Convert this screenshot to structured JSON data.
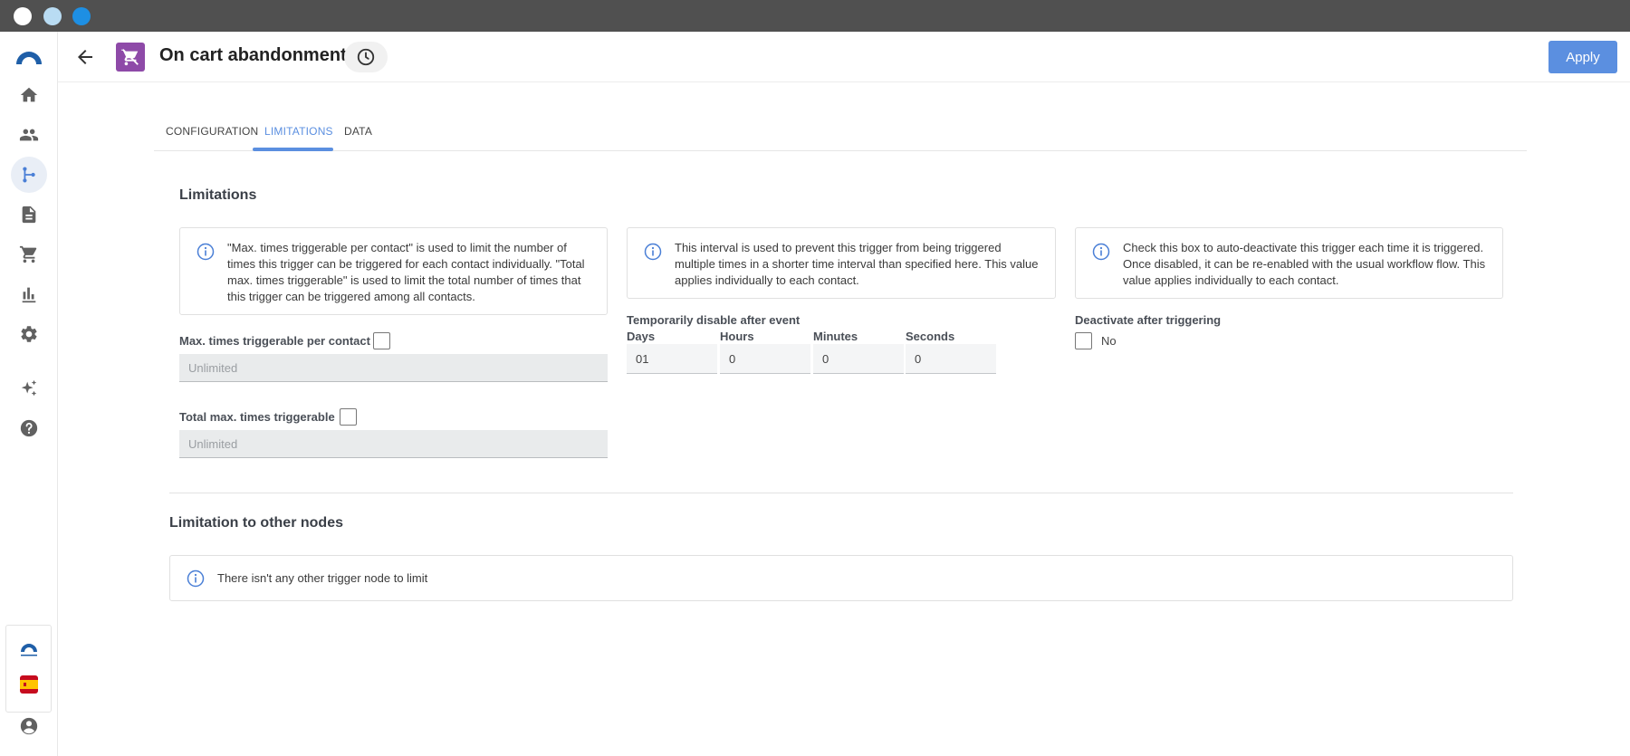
{
  "app": {
    "title": "On cart abandonment",
    "apply_label": "Apply"
  },
  "sidebar": {
    "items": [
      {
        "name": "home",
        "icon": "home-icon"
      },
      {
        "name": "contacts",
        "icon": "people-icon"
      },
      {
        "name": "workflows",
        "icon": "workflow-icon",
        "active": true
      },
      {
        "name": "documents",
        "icon": "document-icon"
      },
      {
        "name": "cart",
        "icon": "cart-icon"
      },
      {
        "name": "reports",
        "icon": "bar-chart-icon"
      },
      {
        "name": "settings",
        "icon": "gear-icon"
      },
      {
        "name": "ai",
        "icon": "sparkles-icon"
      },
      {
        "name": "help",
        "icon": "help-icon"
      }
    ],
    "bottom": {
      "logo_icon": "connectif-logo-icon",
      "flag_icon": "spain-flag-icon",
      "user_icon": "account-icon"
    }
  },
  "tabs": [
    {
      "label": "CONFIGURATION"
    },
    {
      "label": "LIMITATIONS",
      "active": true
    },
    {
      "label": "DATA"
    }
  ],
  "limitations": {
    "title": "Limitations",
    "info_contact": "\"Max. times triggerable per contact\" is used to limit the number of times this trigger can be triggered for each contact individually. \"Total max. times triggerable\" is used to limit the total number of times that this trigger can be triggered among all contacts.",
    "info_interval": "This interval is used to prevent this trigger from being triggered multiple times in a shorter time interval than specified here. This value applies individually to each contact.",
    "info_deactivate": "Check this box to auto-deactivate this trigger each time it is triggered. Once disabled, it can be re-enabled with the usual workflow flow. This value applies individually to each contact.",
    "max_per_contact_label": "Max. times triggerable per contact",
    "max_per_contact_placeholder": "Unlimited",
    "total_max_label": "Total max. times triggerable",
    "total_max_placeholder": "Unlimited",
    "temp_disable_label": "Temporarily disable after event",
    "days_label": "Days",
    "hours_label": "Hours",
    "minutes_label": "Minutes",
    "seconds_label": "Seconds",
    "days_value": "01",
    "hours_value": "0",
    "minutes_value": "0",
    "seconds_value": "0",
    "deactivate_label": "Deactivate after triggering",
    "deactivate_value": "No"
  },
  "other_nodes": {
    "title": "Limitation to other nodes",
    "info": "There isn't any other trigger node to limit"
  },
  "colors": {
    "accent": "#5b8fe0",
    "node_icon_bg": "#8e4aa8",
    "brand_logo": "#1f5fa8"
  }
}
